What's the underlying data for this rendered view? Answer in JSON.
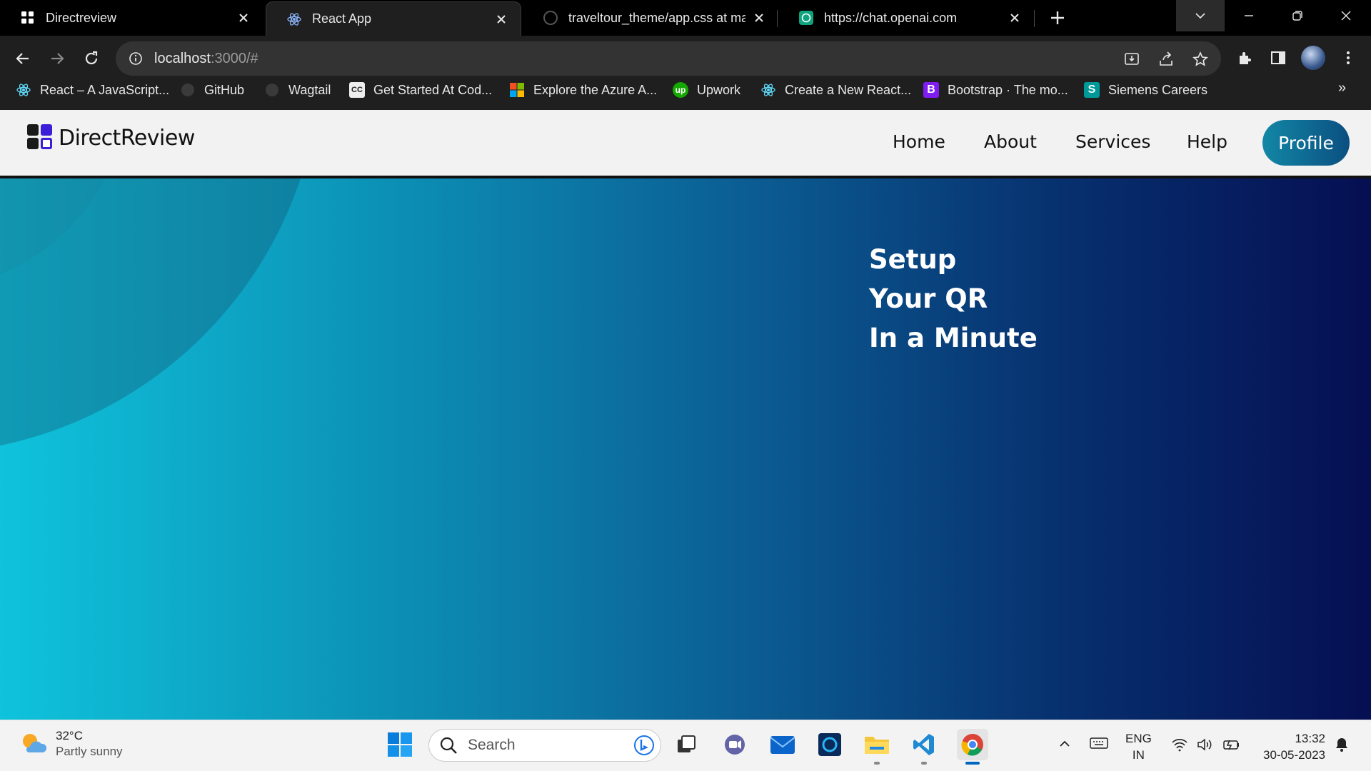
{
  "browser": {
    "tabs": [
      {
        "title": "Directreview",
        "icon": "grid-app-icon"
      },
      {
        "title": "React App",
        "icon": "react-icon"
      },
      {
        "title": "traveltour_theme/app.css at main",
        "icon": "github-icon"
      },
      {
        "title": "https://chat.openai.com",
        "icon": "openai-icon"
      }
    ],
    "url_host": "localhost",
    "url_rest": ":3000/#",
    "bookmarks": [
      {
        "label": "React – A JavaScript...",
        "icon": "react-icon"
      },
      {
        "label": "GitHub",
        "icon": "github-icon"
      },
      {
        "label": "Wagtail",
        "icon": "github-icon"
      },
      {
        "label": "Get Started At Cod...",
        "icon": "cc-icon",
        "glyph": "CC"
      },
      {
        "label": "Explore the Azure A...",
        "icon": "microsoft-icon"
      },
      {
        "label": "Upwork",
        "icon": "upwork-icon",
        "glyph": "up"
      },
      {
        "label": "Create a New React...",
        "icon": "react-icon"
      },
      {
        "label": "Bootstrap · The mo...",
        "icon": "bootstrap-icon",
        "glyph": "B"
      },
      {
        "label": "Siemens Careers",
        "icon": "siemens-icon",
        "glyph": "S"
      }
    ],
    "bookmarks_more": "»"
  },
  "site": {
    "logo_text": "DirectReview",
    "nav": [
      "Home",
      "About",
      "Services",
      "Help"
    ],
    "profile_label": "Profile",
    "hero_lines": [
      "Setup",
      "Your QR",
      "In a Minute"
    ]
  },
  "taskbar": {
    "weather_temp": "32°C",
    "weather_desc": "Partly sunny",
    "search_placeholder": "Search",
    "lang_line1": "ENG",
    "lang_line2": "IN",
    "time": "13:32",
    "date": "30-05-2023"
  },
  "colors": {
    "hero_start": "#0fc3dc",
    "hero_end": "#050f52",
    "profile_button": "#0b6b93"
  }
}
